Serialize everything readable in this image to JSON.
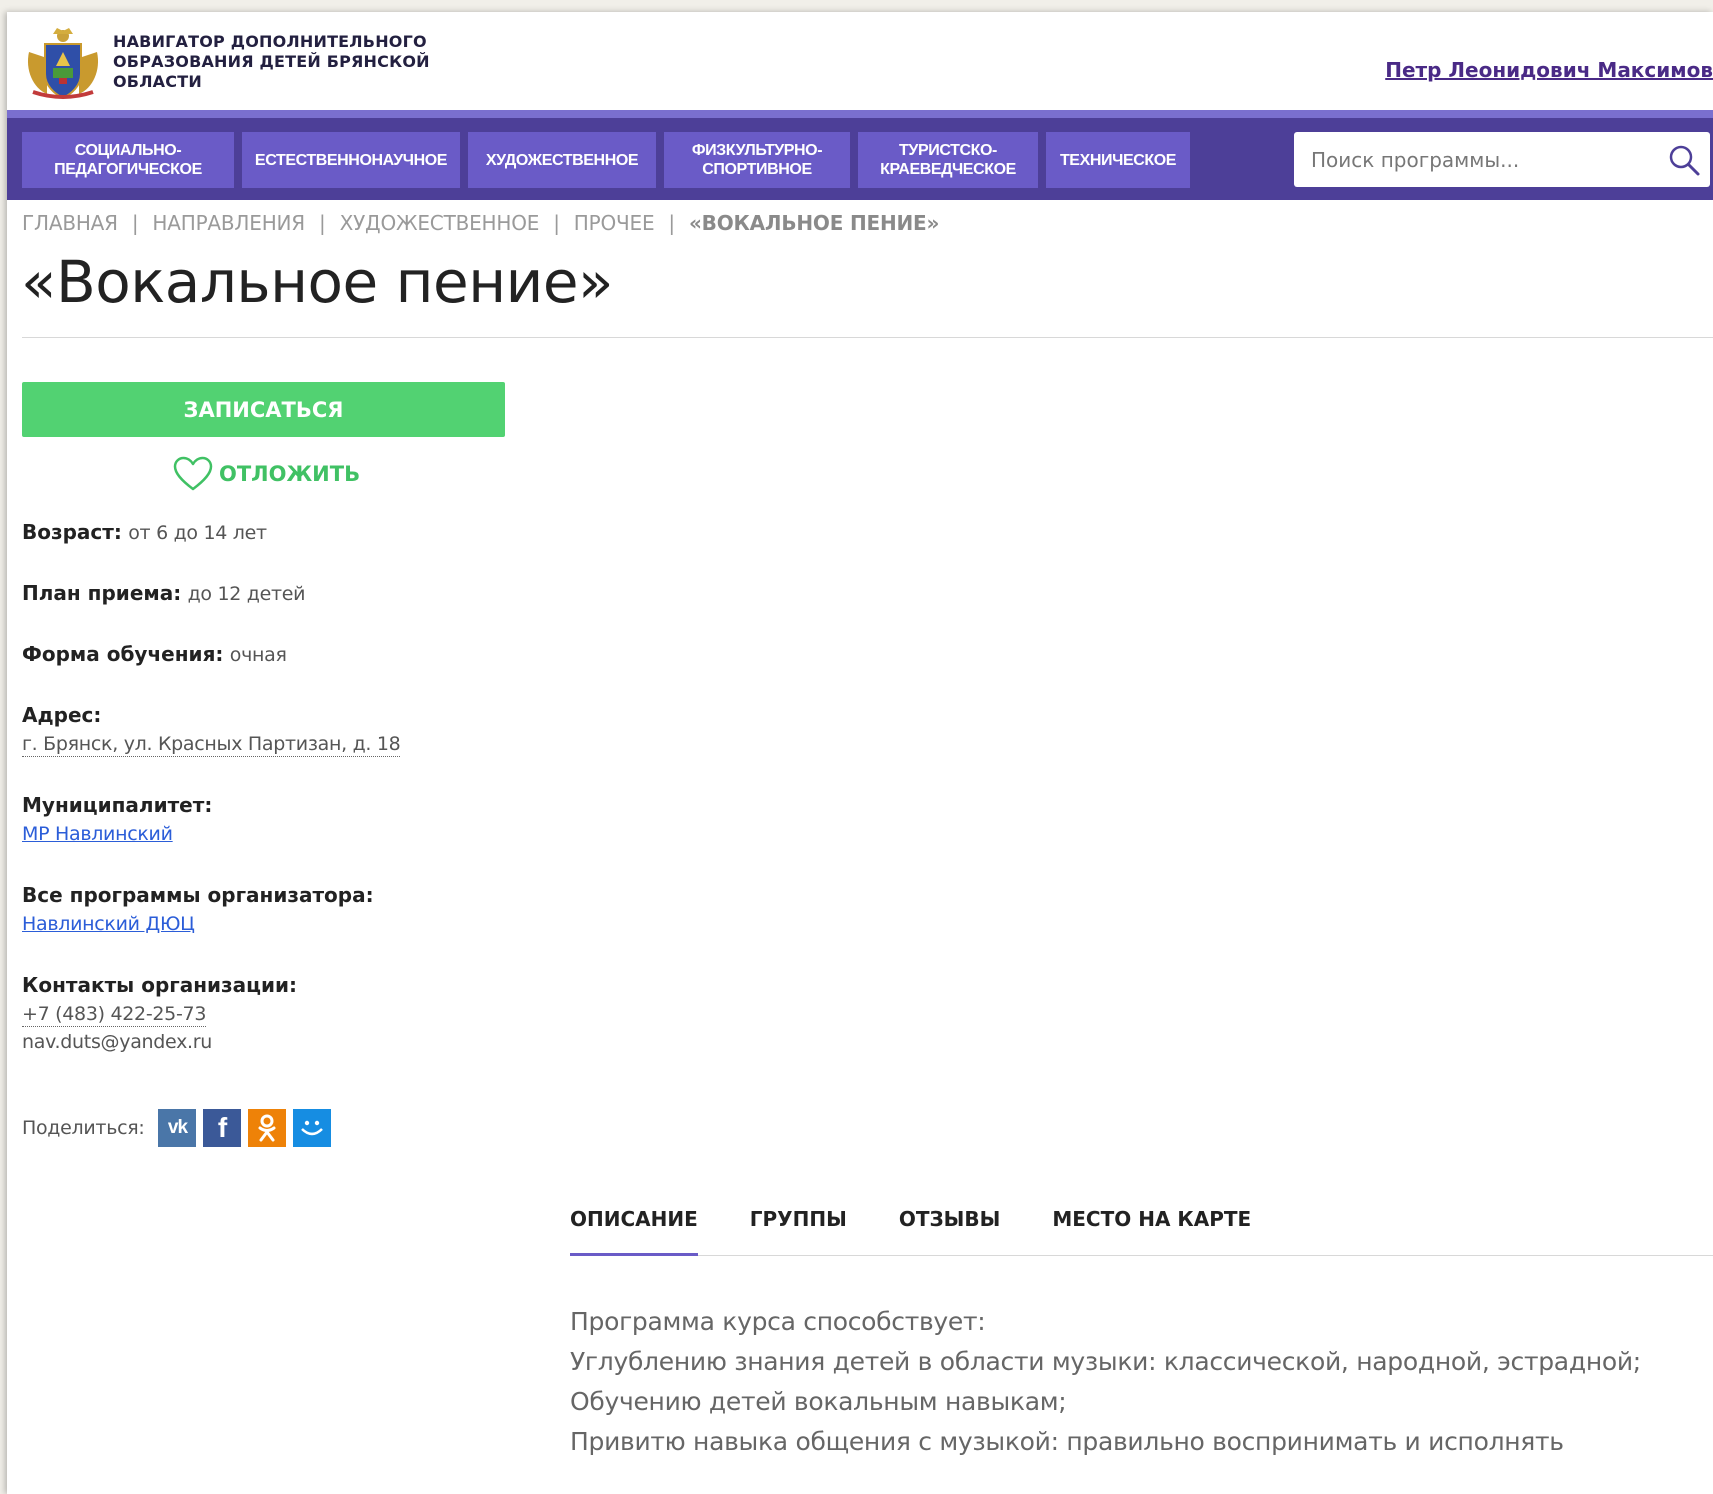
{
  "header": {
    "logo_text": "НАВИГАТОР ДОПОЛНИТЕЛЬНОГО ОБРАЗОВАНИЯ ДЕТЕЙ БРЯНСКОЙ ОБЛАСТИ",
    "user_name": "Петр Леонидович Максимов"
  },
  "nav": {
    "items": [
      {
        "label": "СОЦИАЛЬНО-\nПЕДАГОГИЧЕСКОЕ"
      },
      {
        "label": "ЕСТЕСТВЕННОНАУЧНОЕ"
      },
      {
        "label": "ХУДОЖЕСТВЕННОЕ"
      },
      {
        "label": "ФИЗКУЛЬТУРНО-\nСПОРТИВНОЕ"
      },
      {
        "label": "ТУРИСТСКО-\nКРАЕВЕДЧЕСКОЕ"
      },
      {
        "label": "ТЕХНИЧЕСКОЕ"
      }
    ],
    "search_placeholder": "Поиск программы..."
  },
  "breadcrumb": [
    "ГЛАВНАЯ",
    "НАПРАВЛЕНИЯ",
    "ХУДОЖЕСТВЕННОЕ",
    "ПРОЧЕЕ",
    "«ВОКАЛЬНОЕ ПЕНИЕ»"
  ],
  "title": "«Вокальное пение»",
  "actions": {
    "enroll": "ЗАПИСАТЬСЯ",
    "postpone": "ОТЛОЖИТЬ"
  },
  "info": {
    "age_label": "Возраст:",
    "age_value": "от 6 до 14 лет",
    "plan_label": "План приема:",
    "plan_value": "до 12 детей",
    "form_label": "Форма обучения:",
    "form_value": "очная",
    "address_label": "Адрес:",
    "address_value": "г. Брянск, ул. Красных Партизан, д. 18",
    "municipality_label": "Муниципалитет:",
    "municipality_value": "МР Навлинский",
    "organizer_label": "Все программы организатора:",
    "organizer_value": "Навлинский ДЮЦ",
    "contacts_label": "Контакты организации:",
    "phone": "+7 (483) 422-25-73",
    "email": "nav.duts@yandex.ru",
    "share_label": "Поделиться:"
  },
  "share_icons": [
    {
      "name": "vk",
      "color": "#4a76a8"
    },
    {
      "name": "facebook",
      "color": "#3b5998"
    },
    {
      "name": "odnoklassniki",
      "color": "#ee8208"
    },
    {
      "name": "moimir",
      "color": "#168de2"
    }
  ],
  "colors": {
    "nav_bg": "#4d3f98",
    "nav_item": "#6a5bc7",
    "accent_green": "#52d272",
    "link_blue": "#2b5dd8",
    "user_link": "#4a2a86"
  },
  "tabs": [
    {
      "label": "ОПИСАНИЕ",
      "active": true
    },
    {
      "label": "ГРУППЫ",
      "active": false
    },
    {
      "label": "ОТЗЫВЫ",
      "active": false
    },
    {
      "label": "МЕСТО НА КАРТЕ",
      "active": false
    }
  ],
  "description": [
    "Программа курса способствует:",
    "Углублению знания детей в области музыки: классической, народной, эстрадной;",
    "Обучению детей вокальным навыкам;",
    "Привитю навыка общения с музыкой: правильно воспринимать и исполнять"
  ]
}
